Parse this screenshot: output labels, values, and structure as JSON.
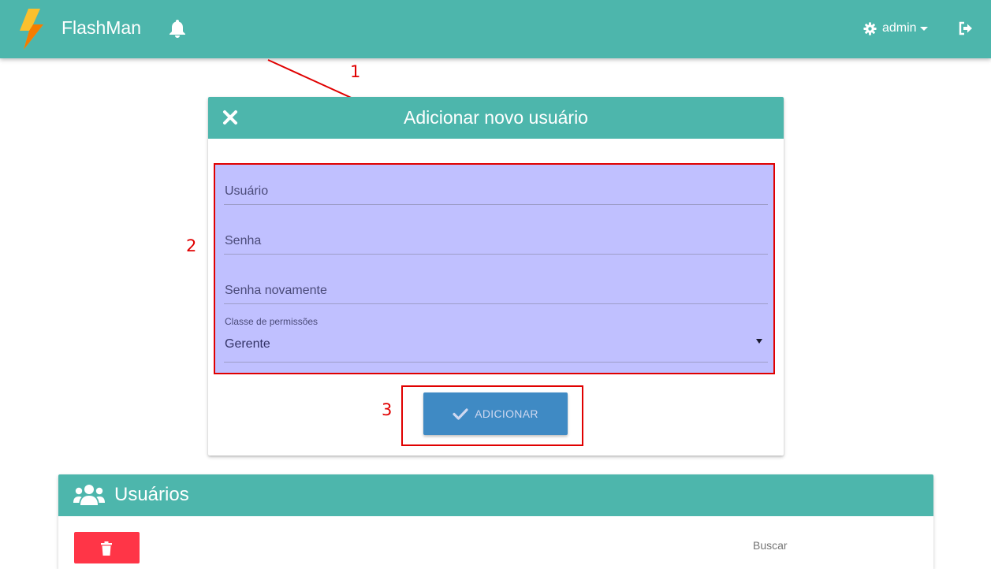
{
  "navbar": {
    "brand_name": "FlashMan",
    "user_label": "admin",
    "colors": {
      "bar": "#4db6ac"
    },
    "icons": [
      "flash-logo-icon",
      "bell-icon",
      "gear-icon",
      "caret-down-icon",
      "logout-icon"
    ]
  },
  "add_user_card": {
    "title": "Adicionar novo usuário",
    "fields": {
      "username_placeholder": "Usuário",
      "password_placeholder": "Senha",
      "password_confirm_placeholder": "Senha novamente",
      "permission_label": "Classe de permissões",
      "permission_value": "Gerente"
    },
    "submit_label": "ADICIONAR",
    "icons": [
      "close-icon",
      "check-icon",
      "dropdown-arrow-icon"
    ]
  },
  "annotations": {
    "one": "1",
    "two": "2",
    "three": "3",
    "color": "#e00000"
  },
  "users_card": {
    "title": "Usuários",
    "search_label": "Buscar",
    "icons": [
      "users-group-icon",
      "trash-icon"
    ],
    "colors": {
      "delete": "#ff3547"
    }
  }
}
